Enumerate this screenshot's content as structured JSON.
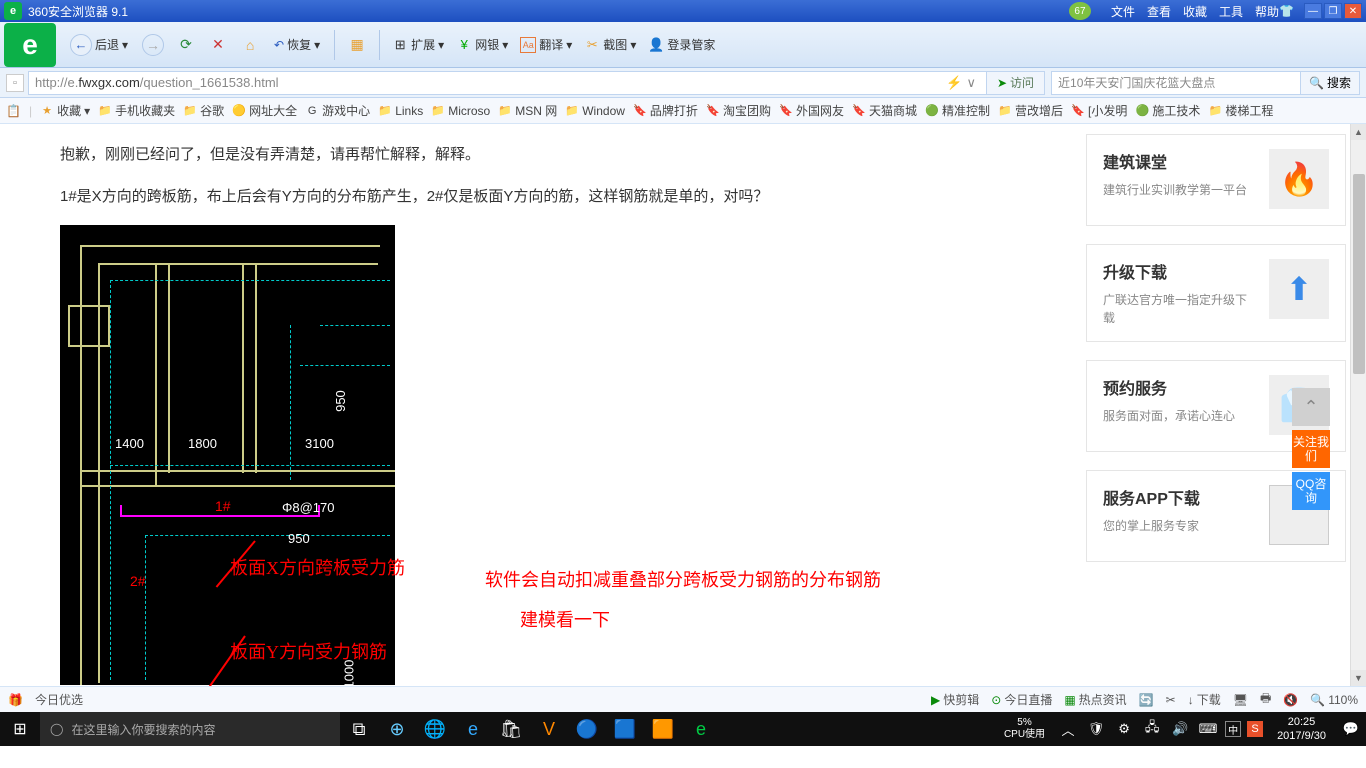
{
  "titlebar": {
    "app": "360安全浏览器 9.1",
    "badge": "67",
    "menu": [
      "文件",
      "查看",
      "收藏",
      "工具",
      "帮助"
    ]
  },
  "toolbar": {
    "back": "后退",
    "restore": "恢复",
    "items": [
      {
        "icon": "⊞",
        "label": "扩展"
      },
      {
        "icon": "¥",
        "label": "网银"
      },
      {
        "icon": "Aа",
        "label": "翻译"
      },
      {
        "icon": "✂",
        "label": "截图"
      },
      {
        "icon": "👤",
        "label": "登录管家"
      }
    ]
  },
  "addressbar": {
    "url_grey1": "http://e.",
    "url_dark": "fwxgx.com",
    "url_grey2": "/question_1661538.html",
    "visit": "访问",
    "placeholder": "近10年天安门国庆花篮大盘点",
    "search": "搜索"
  },
  "bookmarks": [
    {
      "icon": "★",
      "label": "收藏",
      "cls": "star"
    },
    {
      "icon": "📁",
      "label": "手机收藏夹",
      "cls": "folder"
    },
    {
      "icon": "📁",
      "label": "谷歌",
      "cls": "folder"
    },
    {
      "icon": "🟡",
      "label": "网址大全"
    },
    {
      "icon": "G",
      "label": "游戏中心"
    },
    {
      "icon": "📁",
      "label": "Links",
      "cls": "folder"
    },
    {
      "icon": "📁",
      "label": "Microso",
      "cls": "folder"
    },
    {
      "icon": "📁",
      "label": "MSN 网",
      "cls": "folder"
    },
    {
      "icon": "📁",
      "label": "Window",
      "cls": "folder"
    },
    {
      "icon": "🔖",
      "label": "品牌打折"
    },
    {
      "icon": "🔖",
      "label": "淘宝团购"
    },
    {
      "icon": "🔖",
      "label": "外国网友"
    },
    {
      "icon": "🔖",
      "label": "天猫商城"
    },
    {
      "icon": "🟢",
      "label": "精准控制"
    },
    {
      "icon": "📁",
      "label": "营改增后",
      "cls": "folder"
    },
    {
      "icon": "🔖",
      "label": "[小发明"
    },
    {
      "icon": "🟢",
      "label": "施工技术"
    },
    {
      "icon": "📁",
      "label": "楼梯工程",
      "cls": "folder"
    }
  ],
  "main": {
    "p1": "抱歉，刚刚已经问了，但是没有弄清楚，请再帮忙解释，解释。",
    "p2": "1#是X方向的跨板筋，布上后会有Y方向的分布筋产生，2#仅是板面Y方向的筋，这样钢筋就是单的，对吗？",
    "cad": {
      "d1": "1400",
      "d2": "1800",
      "d3": "3100",
      "d4": "950",
      "d5": "950",
      "d6": "1000",
      "phi": "Φ8@170",
      "m1": "1#",
      "m2": "2#"
    },
    "anno1": "板面X方向跨板受力筋",
    "anno2": "板面Y方向受力钢筋",
    "anno3": "软件会自动扣减重叠部分跨板受力钢筋的分布钢筋",
    "anno4": "建模看一下"
  },
  "cards": [
    {
      "title": "建筑课堂",
      "desc": "建筑行业实训教学第一平台",
      "img": "🔥"
    },
    {
      "title": "升级下载",
      "desc": "广联达官方唯一指定升级下载",
      "img": "⬆"
    },
    {
      "title": "预约服务",
      "desc": "服务面对面，承诺心连心",
      "img": "👔"
    },
    {
      "title": "服务APP下载",
      "desc": "您的掌上服务专家",
      "img": "qr"
    }
  ],
  "float": {
    "f1": "关注我们",
    "f2": "QQ咨询",
    "top": "⌃"
  },
  "statusbar": {
    "left": "今日优选",
    "right": [
      {
        "icon": "▶",
        "label": "快剪辑"
      },
      {
        "icon": "⊙",
        "label": "今日直播"
      },
      {
        "icon": "▦",
        "label": "热点资讯"
      },
      {
        "icon": "↓",
        "label": "下载"
      }
    ],
    "zoom": "110%"
  },
  "taskbar": {
    "search": "在这里输入你要搜索的内容",
    "cpu_pct": "5%",
    "cpu_lbl": "CPU使用",
    "time": "20:25",
    "date": "2017/9/30"
  }
}
